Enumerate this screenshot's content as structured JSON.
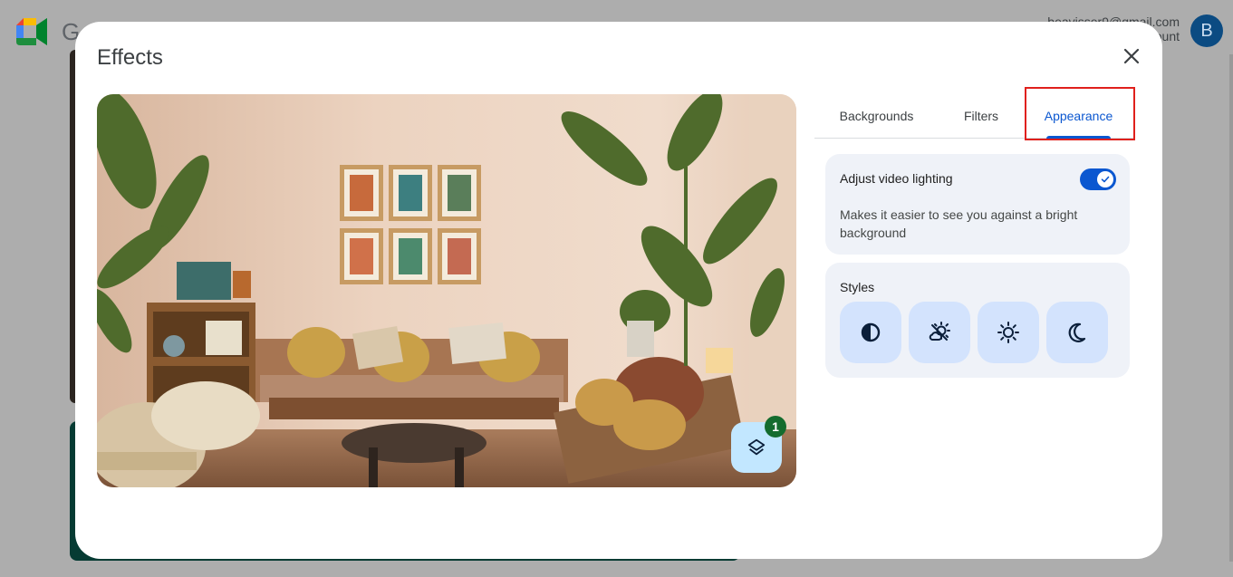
{
  "background_app": {
    "logo_letter": "G",
    "account_email": "beavisser9@gmail.com",
    "account_sub": "Google Account",
    "avatar_letter": "B"
  },
  "dialog": {
    "title": "Effects",
    "close_label": "Close",
    "tabs": [
      {
        "label": "Backgrounds",
        "selected": false
      },
      {
        "label": "Filters",
        "selected": false
      },
      {
        "label": "Appearance",
        "selected": true
      }
    ],
    "lighting": {
      "title": "Adjust video lighting",
      "description": "Makes it easier to see you against a bright background",
      "enabled": true
    },
    "styles": {
      "title": "Styles",
      "items": [
        {
          "icon": "contrast-icon"
        },
        {
          "icon": "partly-cloudy-icon"
        },
        {
          "icon": "sun-icon"
        },
        {
          "icon": "moon-icon"
        }
      ]
    },
    "preview": {
      "layers_badge_count": "1"
    }
  },
  "colors": {
    "accent": "#0b57d0",
    "style_button_bg": "#d3e3fd",
    "card_bg": "#eff2f8",
    "badge_green": "#146c2e",
    "highlight_red": "#e0201c"
  }
}
